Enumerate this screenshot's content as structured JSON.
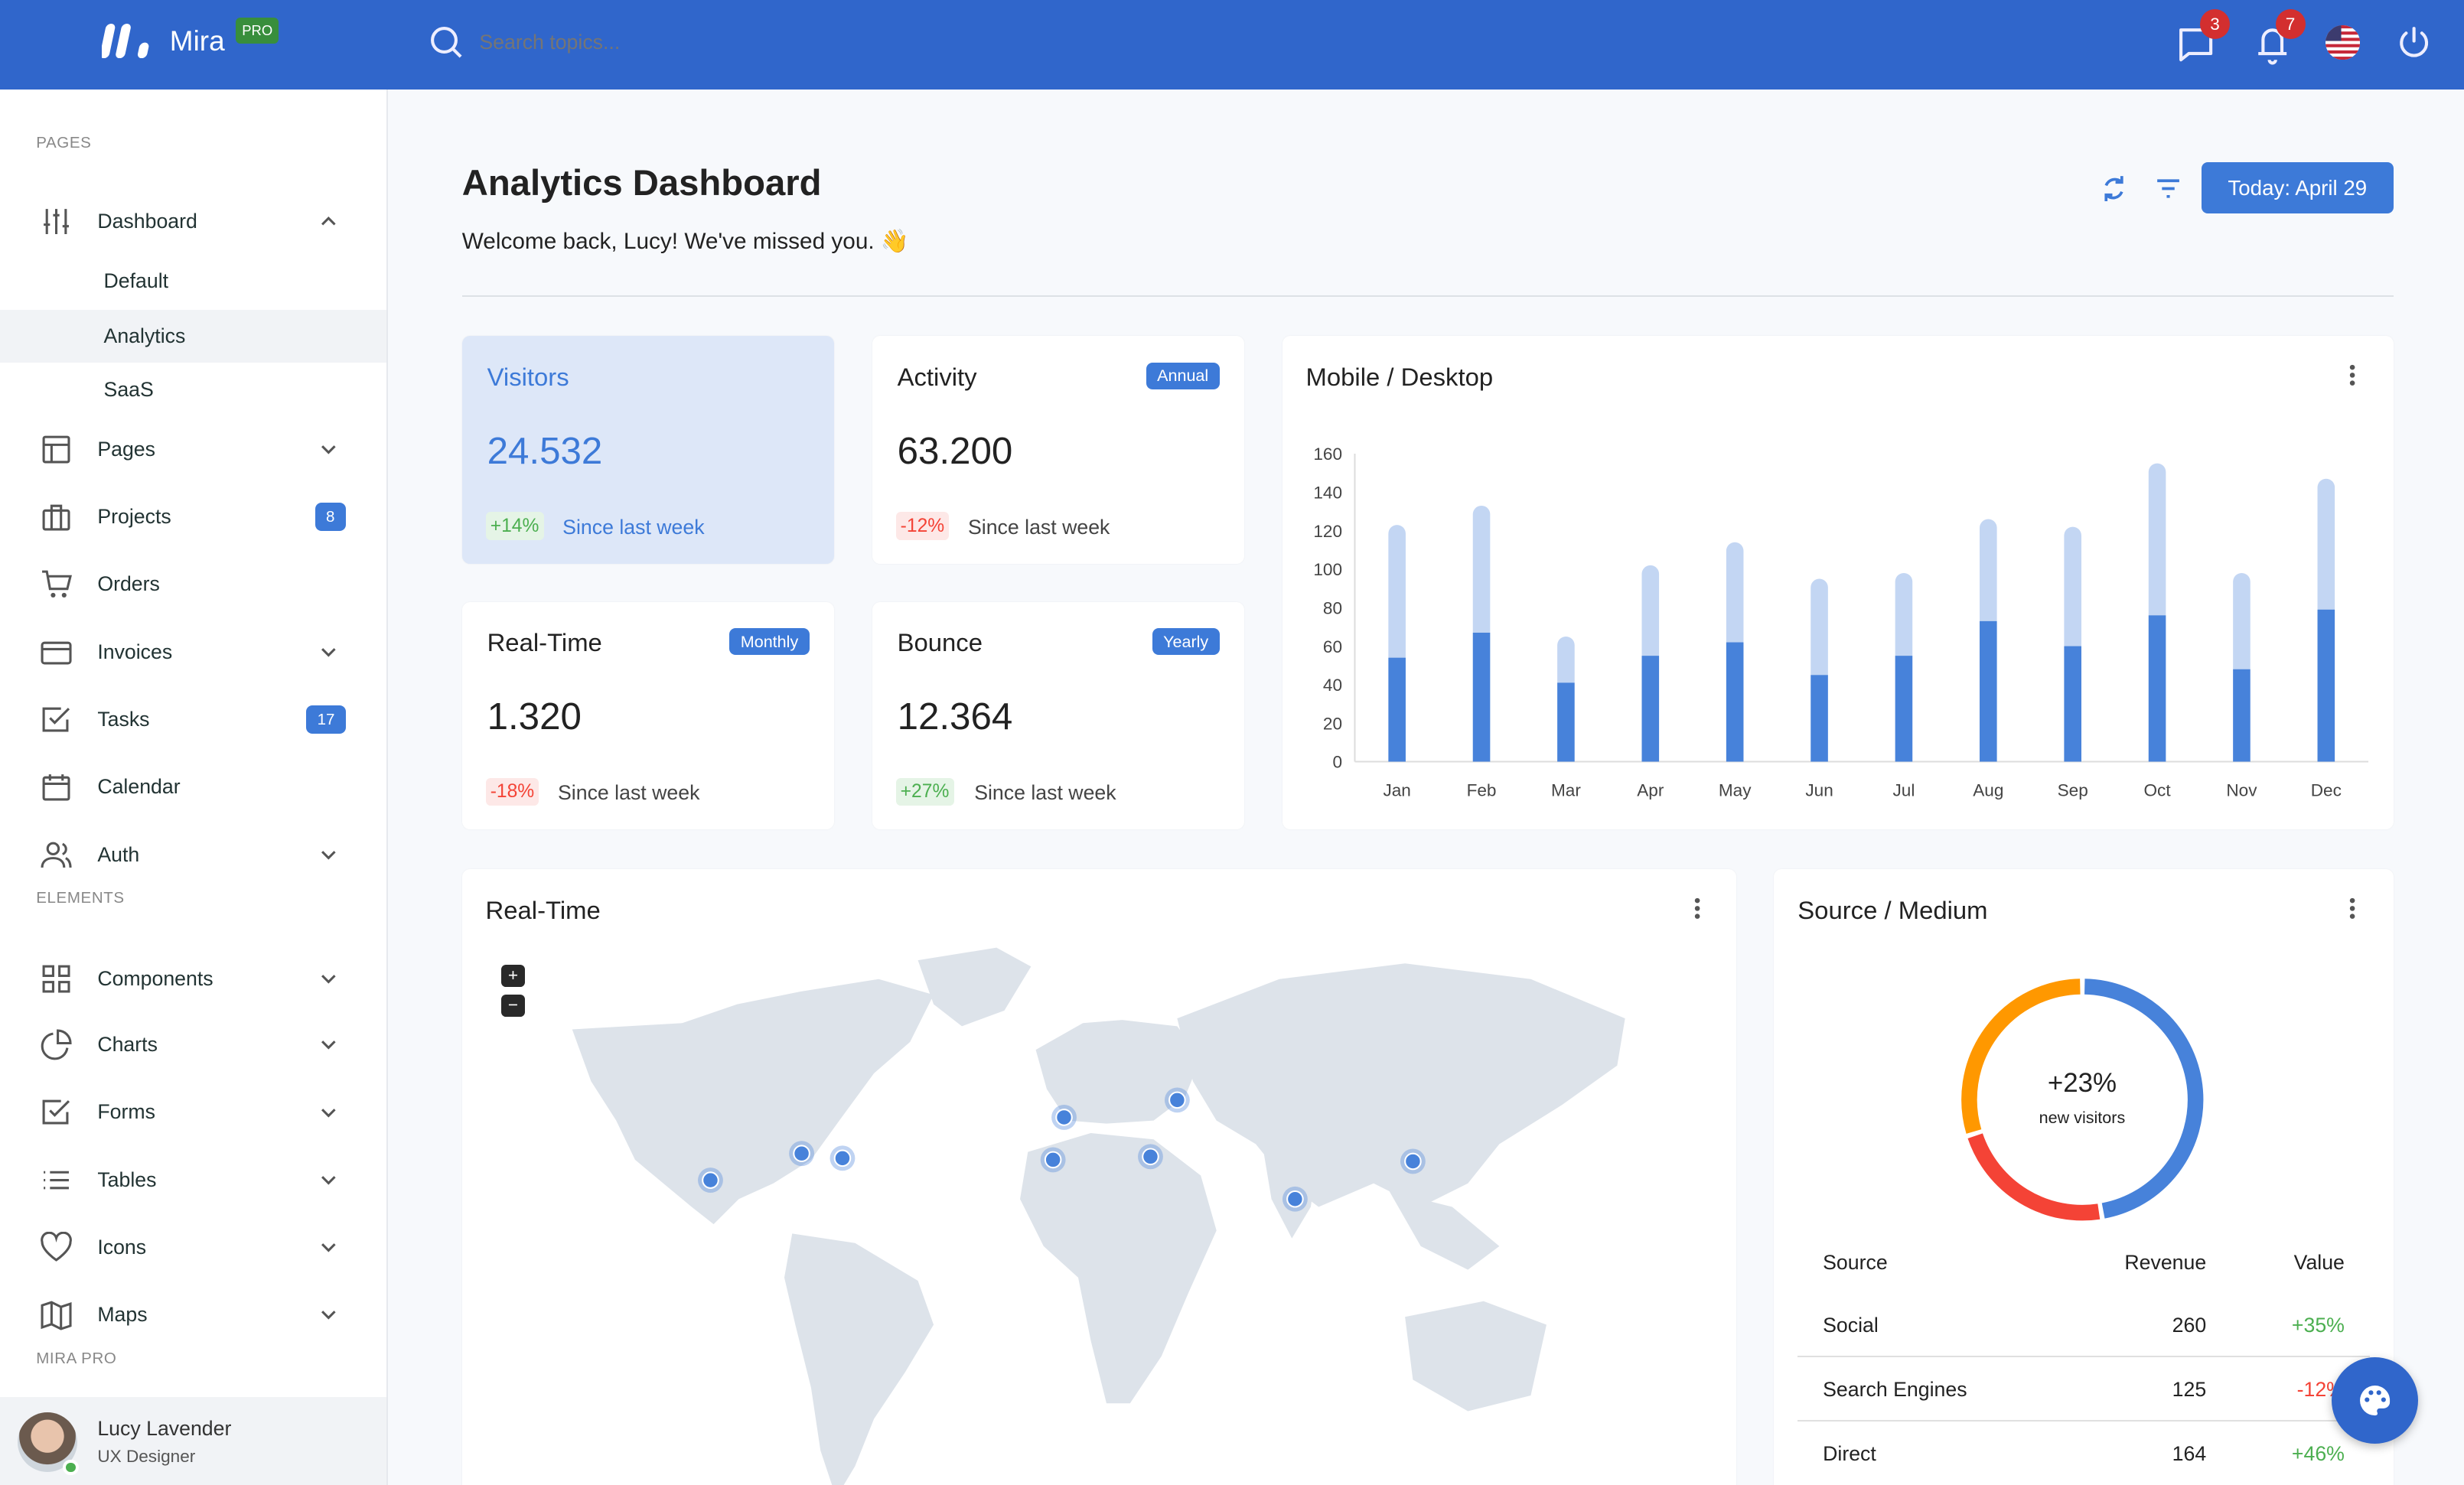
{
  "header": {
    "brand": "Mira",
    "brand_badge": "PRO",
    "search_placeholder": "Search topics...",
    "messages_count": "3",
    "notifications_count": "7",
    "language_flag": "us-flag-icon"
  },
  "sidebar": {
    "sections": [
      "PAGES",
      "ELEMENTS",
      "MIRA PRO"
    ],
    "items": [
      {
        "label": "Dashboard",
        "icon": "sliders-icon",
        "expanded": true
      },
      {
        "label": "Default"
      },
      {
        "label": "Analytics",
        "active": true
      },
      {
        "label": "SaaS"
      },
      {
        "label": "Pages",
        "icon": "layout-icon"
      },
      {
        "label": "Projects",
        "icon": "briefcase-icon",
        "badge": "8"
      },
      {
        "label": "Orders",
        "icon": "cart-icon"
      },
      {
        "label": "Invoices",
        "icon": "credit-card-icon"
      },
      {
        "label": "Tasks",
        "icon": "check-square-icon",
        "badge": "17"
      },
      {
        "label": "Calendar",
        "icon": "calendar-icon"
      },
      {
        "label": "Auth",
        "icon": "users-icon"
      },
      {
        "label": "Components",
        "icon": "grid-icon"
      },
      {
        "label": "Charts",
        "icon": "pie-chart-icon"
      },
      {
        "label": "Forms",
        "icon": "check-square-icon"
      },
      {
        "label": "Tables",
        "icon": "list-icon"
      },
      {
        "label": "Icons",
        "icon": "heart-icon"
      },
      {
        "label": "Maps",
        "icon": "map-icon"
      }
    ],
    "user": {
      "name": "Lucy Lavender",
      "role": "UX Designer",
      "status": "online"
    }
  },
  "page": {
    "title": "Analytics Dashboard",
    "welcome": "Welcome back, Lucy! We've missed you. 👋",
    "date_button": "Today: April 29"
  },
  "stats": [
    {
      "title": "Visitors",
      "value": "24.532",
      "change": "+14%",
      "since": "Since last week"
    },
    {
      "title": "Activity",
      "tag": "Annual",
      "value": "63.200",
      "change": "-12%",
      "since": "Since last week"
    },
    {
      "title": "Real-Time",
      "tag": "Monthly",
      "value": "1.320",
      "change": "-18%",
      "since": "Since last week"
    },
    {
      "title": "Bounce",
      "tag": "Yearly",
      "value": "12.364",
      "change": "+27%",
      "since": "Since last week"
    }
  ],
  "colors": {
    "primary": "#3066cb",
    "desktop": "#4782da",
    "mobile": "#c3d6f3",
    "social": "#4782da",
    "search": "#f44336",
    "direct": "#ff9800"
  },
  "chart_data": [
    {
      "type": "bar",
      "stacked": true,
      "title": "Mobile / Desktop",
      "categories": [
        "Jan",
        "Feb",
        "Mar",
        "Apr",
        "May",
        "Jun",
        "Jul",
        "Aug",
        "Sep",
        "Oct",
        "Nov",
        "Dec"
      ],
      "series": [
        {
          "values": [
            54,
            67,
            41,
            55,
            62,
            45,
            55,
            73,
            60,
            76,
            48,
            79
          ]
        },
        {
          "values": [
            69,
            66,
            24,
            47,
            52,
            50,
            43,
            53,
            62,
            79,
            50,
            68
          ]
        }
      ],
      "yticks": [
        0,
        20,
        40,
        60,
        80,
        100,
        120,
        140,
        160
      ],
      "ylim": [
        0,
        160
      ],
      "grid": false
    },
    {
      "type": "pie",
      "donut": true,
      "title": "Source / Medium",
      "center_value": "+23%",
      "center_label": "new visitors",
      "categories": [
        "Social",
        "Search Engines",
        "Direct"
      ],
      "values": [
        260,
        125,
        164
      ]
    }
  ],
  "realtime": {
    "title": "Real-Time",
    "zoom_in": "+",
    "zoom_out": "−"
  },
  "source_table": {
    "headers": [
      "Source",
      "Revenue",
      "Value"
    ],
    "rows": [
      {
        "source": "Social",
        "revenue": "260",
        "value": "+35%",
        "trend": "up"
      },
      {
        "source": "Search Engines",
        "revenue": "125",
        "value": "-12%",
        "trend": "down"
      },
      {
        "source": "Direct",
        "revenue": "164",
        "value": "+46%",
        "trend": "up"
      }
    ]
  }
}
